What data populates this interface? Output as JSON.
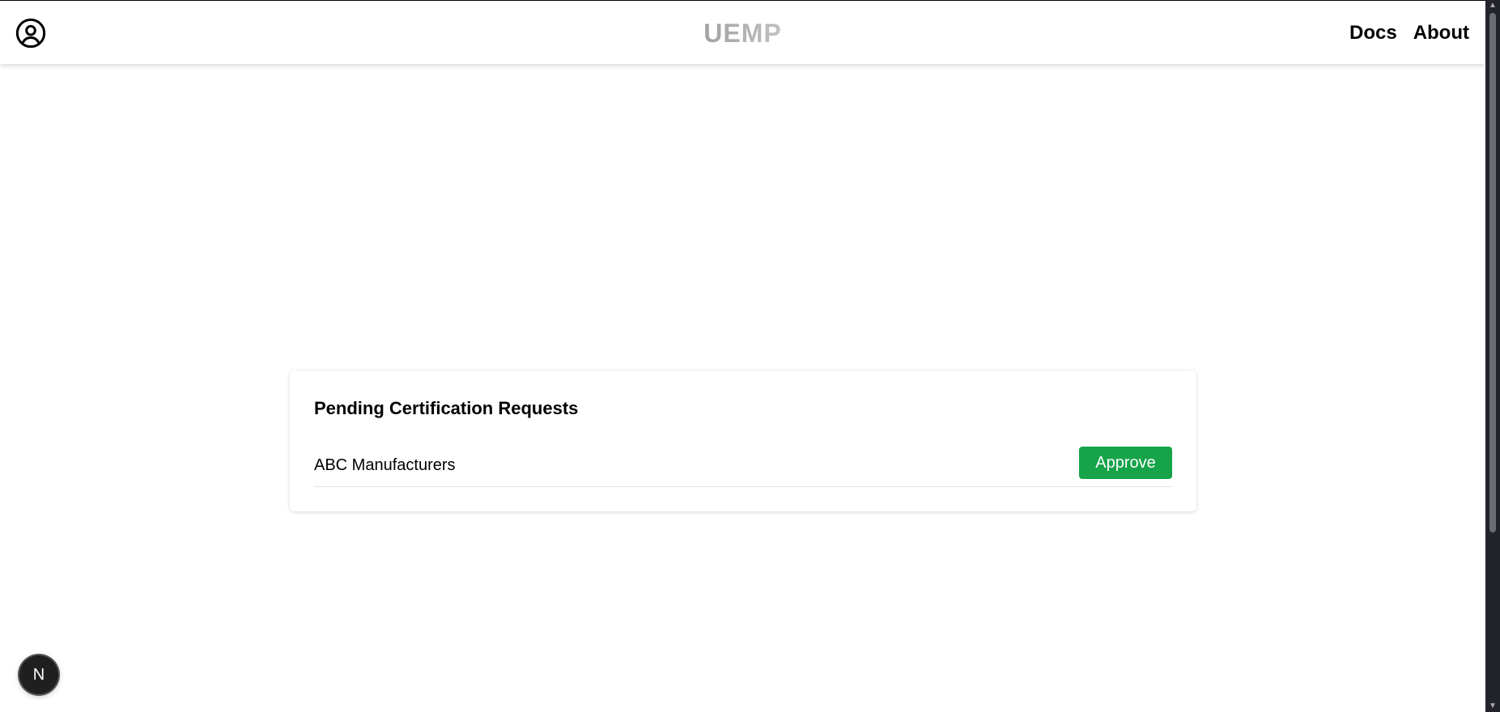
{
  "header": {
    "brand": "UEMP",
    "nav": [
      {
        "label": "Docs"
      },
      {
        "label": "About"
      }
    ],
    "user_icon": "user-circle-icon"
  },
  "main": {
    "card_title": "Pending Certification Requests",
    "requests": [
      {
        "company": "ABC Manufacturers",
        "action_label": "Approve"
      }
    ]
  },
  "dev_badge": {
    "label": "N"
  },
  "colors": {
    "approve": "#16a34a",
    "badge_bg": "#1f1f1f",
    "scrollbar": "#23242b"
  }
}
